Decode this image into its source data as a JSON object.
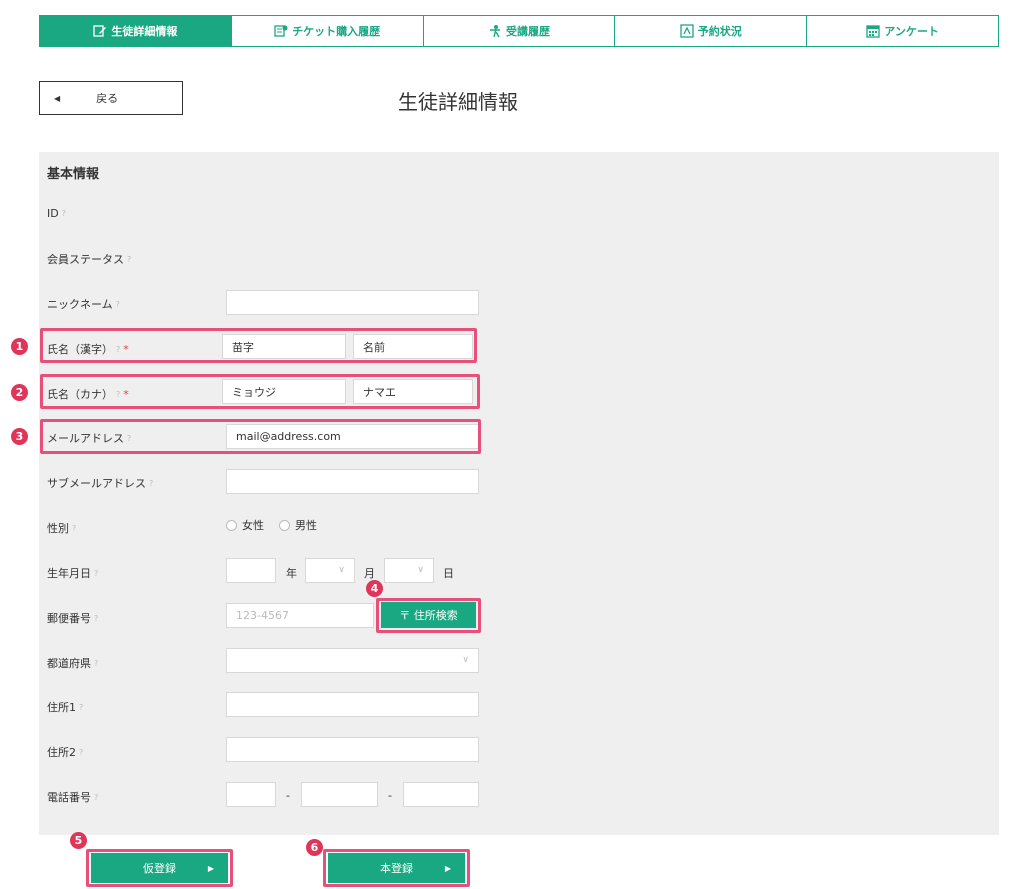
{
  "tabs": [
    {
      "label": "生徒詳細情報",
      "icon": "edit-icon",
      "active": true
    },
    {
      "label": "チケット購入履歴",
      "icon": "ticket-icon",
      "active": false
    },
    {
      "label": "受講履歴",
      "icon": "person-icon",
      "active": false
    },
    {
      "label": "予約状況",
      "icon": "reservation-icon",
      "active": false
    },
    {
      "label": "アンケート",
      "icon": "calendar-icon",
      "active": false
    }
  ],
  "back_button": {
    "label": "戻る"
  },
  "page_title": "生徒詳細情報",
  "section_title": "基本情報",
  "help_mark": "?",
  "required_mark": "*",
  "fields": {
    "id": {
      "label": "ID"
    },
    "member_status": {
      "label": "会員ステータス"
    },
    "nickname": {
      "label": "ニックネーム",
      "value": ""
    },
    "name_kanji": {
      "label": "氏名（漢字）",
      "last": "苗字",
      "first": "名前"
    },
    "name_kana": {
      "label": "氏名（カナ）",
      "last": "ミョウジ",
      "first": "ナマエ"
    },
    "email": {
      "label": "メールアドレス",
      "value": "mail@address.com"
    },
    "sub_email": {
      "label": "サブメールアドレス",
      "value": ""
    },
    "gender": {
      "label": "性別",
      "options": [
        "女性",
        "男性"
      ]
    },
    "birthday": {
      "label": "生年月日",
      "year_unit": "年",
      "month_unit": "月",
      "day_unit": "日"
    },
    "postal": {
      "label": "郵便番号",
      "placeholder": "123-4567",
      "search_button": "〒 住所検索"
    },
    "prefecture": {
      "label": "都道府県"
    },
    "address1": {
      "label": "住所1"
    },
    "address2": {
      "label": "住所2"
    },
    "phone": {
      "label": "電話番号",
      "separator": "-"
    }
  },
  "buttons": {
    "provisional": "仮登録",
    "main": "本登録"
  },
  "badges": [
    "1",
    "2",
    "3",
    "4",
    "5",
    "6"
  ],
  "colors": {
    "accent": "#1aa882",
    "highlight": "#e6507a",
    "badge": "#e0355a"
  }
}
